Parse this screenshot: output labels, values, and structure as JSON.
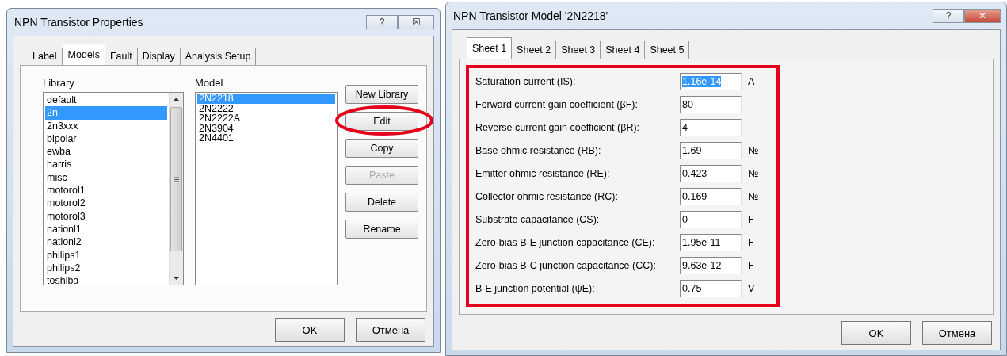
{
  "properties_window": {
    "title": "NPN Transistor Properties",
    "title_buttons": [
      "?",
      "☒"
    ],
    "tabs": [
      {
        "label": "Label",
        "selected": false
      },
      {
        "label": "Models",
        "selected": true
      },
      {
        "label": "Fault",
        "selected": false
      },
      {
        "label": "Display",
        "selected": false
      },
      {
        "label": "Analysis Setup",
        "selected": false
      }
    ],
    "library": {
      "label": "Library",
      "items": [
        {
          "text": "default",
          "selected": false
        },
        {
          "text": "2n",
          "selected": true
        },
        {
          "text": "2n3xxx",
          "selected": false
        },
        {
          "text": "bipolar",
          "selected": false
        },
        {
          "text": "ewba",
          "selected": false
        },
        {
          "text": "harris",
          "selected": false
        },
        {
          "text": "misc",
          "selected": false
        },
        {
          "text": "motorol1",
          "selected": false
        },
        {
          "text": "motorol2",
          "selected": false
        },
        {
          "text": "motorol3",
          "selected": false
        },
        {
          "text": "nationl1",
          "selected": false
        },
        {
          "text": "nationl2",
          "selected": false
        },
        {
          "text": "philips1",
          "selected": false
        },
        {
          "text": "philips2",
          "selected": false
        },
        {
          "text": "toshiba",
          "selected": false
        }
      ]
    },
    "model": {
      "label": "Model",
      "items": [
        {
          "text": "2N2218",
          "selected": true
        },
        {
          "text": "2N2222",
          "selected": false
        },
        {
          "text": "2N2222A",
          "selected": false
        },
        {
          "text": "2N3904",
          "selected": false
        },
        {
          "text": "2N4401",
          "selected": false
        }
      ]
    },
    "buttons": [
      {
        "label": "New Library",
        "disabled": false,
        "circled": false
      },
      {
        "label": "Edit",
        "disabled": false,
        "circled": true
      },
      {
        "label": "Copy",
        "disabled": false,
        "circled": false
      },
      {
        "label": "Paste",
        "disabled": true,
        "circled": false
      },
      {
        "label": "Delete",
        "disabled": false,
        "circled": false
      },
      {
        "label": "Rename",
        "disabled": false,
        "circled": false
      }
    ],
    "footer_buttons": [
      "OK",
      "Отмена"
    ]
  },
  "model_window": {
    "title": "NPN Transistor Model '2N2218'",
    "title_buttons": [
      "?",
      "✕"
    ],
    "tabs": [
      {
        "label": "Sheet 1",
        "selected": true
      },
      {
        "label": "Sheet 2",
        "selected": false
      },
      {
        "label": "Sheet 3",
        "selected": false
      },
      {
        "label": "Sheet 4",
        "selected": false
      },
      {
        "label": "Sheet 5",
        "selected": false
      }
    ],
    "highlighted": true,
    "parameters": [
      {
        "label": "Saturation current (IS):",
        "value": "1.16e-14",
        "unit": "A",
        "selected": true
      },
      {
        "label": "Forward current gain coefficient (βF):",
        "value": "80",
        "selected": false
      },
      {
        "label": "Reverse current gain coefficient (βR):",
        "value": "4",
        "selected": false
      },
      {
        "label": "Base ohmic resistance (RB):",
        "value": "1.69",
        "unit": "№",
        "selected": false
      },
      {
        "label": "Emitter ohmic resistance (RE):",
        "value": "0.423",
        "unit": "№",
        "selected": false
      },
      {
        "label": "Collector ohmic resistance (RC):",
        "value": "0.169",
        "unit": "№",
        "selected": false
      },
      {
        "label": "Substrate capacitance (CS):",
        "value": "0",
        "unit": "F",
        "selected": false
      },
      {
        "label": "Zero-bias B-E junction capacitance (CE):",
        "value": "1.95e-11",
        "unit": "F",
        "selected": false
      },
      {
        "label": "Zero-bias B-C junction capacitance (CC):",
        "value": "9.63e-12",
        "unit": "F",
        "selected": false
      },
      {
        "label": "B-E junction potential (ψE):",
        "value": "0.75",
        "unit": "V",
        "selected": false
      }
    ],
    "footer_buttons": [
      "OK",
      "Отмена"
    ]
  }
}
